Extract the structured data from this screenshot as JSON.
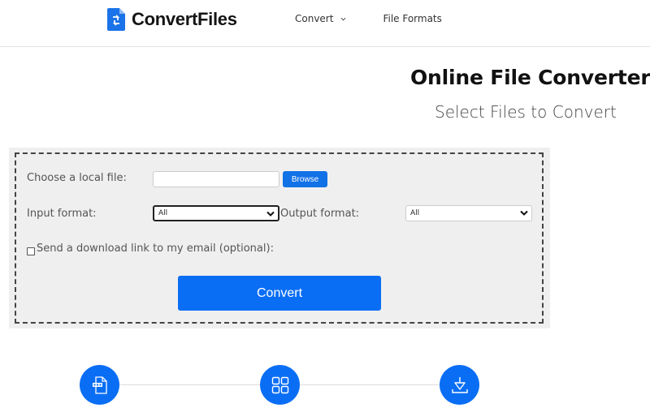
{
  "header": {
    "brand": "ConvertFiles",
    "nav": [
      {
        "label": "Convert",
        "has_dropdown": true
      },
      {
        "label": "File Formats",
        "has_dropdown": false
      }
    ]
  },
  "hero": {
    "title": "Online File Converter",
    "subtitle": "Select Files to Convert"
  },
  "form": {
    "file_label": "Choose a local file:",
    "file_value": "",
    "browse_label": "Browse",
    "input_format_label": "Input format:",
    "input_format_value": "All",
    "output_format_label": "Output format:",
    "output_format_value": "All",
    "email_checkbox_label": "Send a download link to my email (optional):",
    "email_checked": false,
    "convert_label": "Convert"
  },
  "steps": [
    {
      "icon": "file-icon"
    },
    {
      "icon": "grid-icon"
    },
    {
      "icon": "download-icon"
    }
  ],
  "colors": {
    "accent": "#0a6ef5",
    "panel_bg": "#efefef"
  }
}
